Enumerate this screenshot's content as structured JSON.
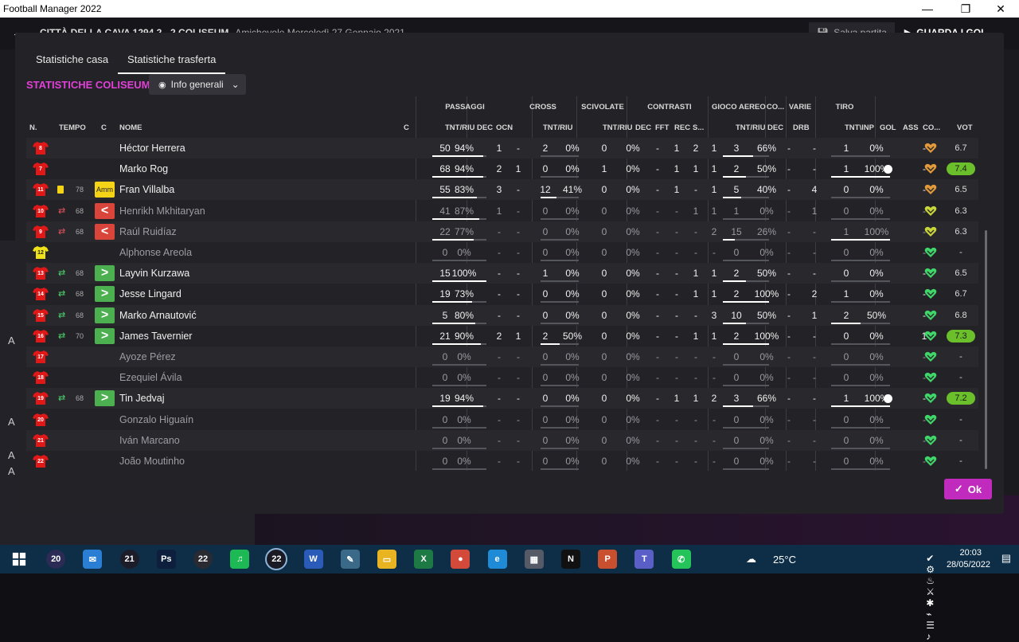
{
  "window": {
    "title": "Football Manager 2022",
    "minimize": "—",
    "maximize": "❐",
    "close": "✕"
  },
  "background": {
    "match_title": "CITTÀ DELLA CAVA 1294 2 - 2 COLISEUM",
    "match_info": "Amichevole   Mercoledì 27 Gennaio 2021",
    "save_label": "Salva partita",
    "watch_label": "GUARDA I GOL",
    "side_letters": [
      "A",
      "A",
      "A",
      "A"
    ]
  },
  "tabs": [
    {
      "label": "Statistiche casa",
      "active": false
    },
    {
      "label": "Statistiche trasferta",
      "active": true
    }
  ],
  "section_title": "STATISTICHE COLISEUM",
  "filter_label": "Info generali",
  "group_headers": [
    "PASSAGGI",
    "CROSS",
    "SCIVOLATE",
    "CONTRASTI",
    "GIOCO AEREO",
    "CO...",
    "VARIE",
    "TIRO"
  ],
  "columns": {
    "n": "N.",
    "tempo": "TEMPO",
    "c": "C",
    "nome": "NOME",
    "c2": "C",
    "pass_tnt": "TNT/RIU",
    "pass_dec": "DEC",
    "pass_ocn": "OCN",
    "cross_tnt": "TNT/RIU",
    "sciv_tnt": "TNT/RIU",
    "con_dec": "DEC",
    "con_fft": "FFT",
    "con_rec": "REC",
    "con_s": "S...",
    "aereo_tnt": "TNT/RIU",
    "co_dec": "DEC",
    "varie_drb": "DRB",
    "tiro_tnt": "TNT\\INP",
    "gol": "GOL",
    "ass": "ASS",
    "co": "CO...",
    "vot": "VOT"
  },
  "players": [
    {
      "n": "8",
      "tempo": "",
      "ev": "",
      "badge": "",
      "name": "Héctor Herrera",
      "dim": false,
      "p": [
        "50",
        "94%",
        "1",
        "-"
      ],
      "cr": [
        "2",
        "0%"
      ],
      "sc": [
        "0",
        "0%"
      ],
      "ct": [
        "-",
        "1",
        "2",
        "1"
      ],
      "ae": [
        "3",
        "66%"
      ],
      "co": "-",
      "drb": "-",
      "ti": [
        "1",
        "0%"
      ],
      "gol": false,
      "ass": "-",
      "heart": "#e39a3a",
      "vot": "6.7",
      "hi": false,
      "pf": 0.94,
      "af": 0.66,
      "tf": 0,
      "cf": 0
    },
    {
      "n": "7",
      "tempo": "",
      "ev": "",
      "badge": "",
      "name": "Marko Rog",
      "dim": false,
      "p": [
        "68",
        "94%",
        "2",
        "1"
      ],
      "cr": [
        "0",
        "0%"
      ],
      "sc": [
        "1",
        "0%"
      ],
      "ct": [
        "-",
        "1",
        "1",
        "1"
      ],
      "ae": [
        "2",
        "50%"
      ],
      "co": "-",
      "drb": "-",
      "ti": [
        "1",
        "100%"
      ],
      "gol": true,
      "ass": "-",
      "heart": "#e39a3a",
      "vot": "7.4",
      "hi": true,
      "pf": 0.94,
      "af": 0.5,
      "tf": 1,
      "cf": 0
    },
    {
      "n": "11",
      "tempo": "78",
      "ev": "yellow",
      "badge": "Amm",
      "name": "Fran Villalba",
      "dim": false,
      "p": [
        "55",
        "83%",
        "3",
        "-"
      ],
      "cr": [
        "12",
        "41%"
      ],
      "sc": [
        "0",
        "0%"
      ],
      "ct": [
        "-",
        "1",
        "-",
        "1"
      ],
      "ae": [
        "5",
        "40%"
      ],
      "co": "-",
      "drb": "4",
      "ti": [
        "0",
        "0%"
      ],
      "gol": false,
      "ass": "-",
      "heart": "#e39a3a",
      "vot": "6.5",
      "hi": false,
      "pf": 0.83,
      "af": 0.4,
      "tf": 0,
      "cf": 0.41
    },
    {
      "n": "10",
      "tempo": "68",
      "ev": "subout",
      "badge": "<",
      "name": "Henrikh Mkhitaryan",
      "dim": true,
      "p": [
        "41",
        "87%",
        "1",
        "-"
      ],
      "cr": [
        "0",
        "0%"
      ],
      "sc": [
        "0",
        "0%"
      ],
      "ct": [
        "-",
        "-",
        "1",
        "1"
      ],
      "ae": [
        "1",
        "0%"
      ],
      "co": "-",
      "drb": "1",
      "ti": [
        "0",
        "0%"
      ],
      "gol": false,
      "ass": "-",
      "heart": "#c9d63a",
      "vot": "6.3",
      "hi": false,
      "pf": 0.87,
      "af": 0,
      "tf": 0,
      "cf": 0
    },
    {
      "n": "9",
      "tempo": "68",
      "ev": "subout",
      "badge": "<",
      "name": "Raúl Ruidíaz",
      "dim": true,
      "p": [
        "22",
        "77%",
        "-",
        "-"
      ],
      "cr": [
        "0",
        "0%"
      ],
      "sc": [
        "0",
        "0%"
      ],
      "ct": [
        "-",
        "-",
        "-",
        "2"
      ],
      "ae": [
        "15",
        "26%"
      ],
      "co": "-",
      "drb": "-",
      "ti": [
        "1",
        "100%"
      ],
      "gol": false,
      "ass": "-",
      "heart": "#c9d63a",
      "vot": "6.3",
      "hi": false,
      "pf": 0.77,
      "af": 0.26,
      "tf": 1,
      "cf": 0
    },
    {
      "n": "12",
      "tempo": "",
      "ev": "",
      "badge": "",
      "name": "Alphonse Areola",
      "dim": true,
      "gk": true,
      "p": [
        "0",
        "0%",
        "-",
        "-"
      ],
      "cr": [
        "0",
        "0%"
      ],
      "sc": [
        "0",
        "0%"
      ],
      "ct": [
        "-",
        "-",
        "-",
        "-"
      ],
      "ae": [
        "0",
        "0%"
      ],
      "co": "-",
      "drb": "-",
      "ti": [
        "0",
        "0%"
      ],
      "gol": false,
      "ass": "-",
      "heart": "#3fd66a",
      "vot": "-",
      "hi": false,
      "pf": 0,
      "af": 0,
      "tf": 0,
      "cf": 0
    },
    {
      "n": "13",
      "tempo": "68",
      "ev": "subin",
      "badge": ">",
      "name": "Layvin Kurzawa",
      "dim": false,
      "p": [
        "15",
        "100%",
        "-",
        "-"
      ],
      "cr": [
        "1",
        "0%"
      ],
      "sc": [
        "0",
        "0%"
      ],
      "ct": [
        "-",
        "-",
        "1",
        "1"
      ],
      "ae": [
        "2",
        "50%"
      ],
      "co": "-",
      "drb": "-",
      "ti": [
        "0",
        "0%"
      ],
      "gol": false,
      "ass": "-",
      "heart": "#3fd66a",
      "vot": "6.5",
      "hi": false,
      "pf": 1,
      "af": 0.5,
      "tf": 0,
      "cf": 0
    },
    {
      "n": "14",
      "tempo": "68",
      "ev": "subin",
      "badge": ">",
      "name": "Jesse Lingard",
      "dim": false,
      "p": [
        "19",
        "73%",
        "-",
        "-"
      ],
      "cr": [
        "0",
        "0%"
      ],
      "sc": [
        "0",
        "0%"
      ],
      "ct": [
        "-",
        "-",
        "1",
        "1"
      ],
      "ae": [
        "2",
        "100%"
      ],
      "co": "-",
      "drb": "2",
      "ti": [
        "1",
        "0%"
      ],
      "gol": false,
      "ass": "-",
      "heart": "#3fd66a",
      "vot": "6.7",
      "hi": false,
      "pf": 0.73,
      "af": 1,
      "tf": 0,
      "cf": 0
    },
    {
      "n": "15",
      "tempo": "68",
      "ev": "subin",
      "badge": ">",
      "name": "Marko Arnautović",
      "dim": false,
      "p": [
        "5",
        "80%",
        "-",
        "-"
      ],
      "cr": [
        "0",
        "0%"
      ],
      "sc": [
        "0",
        "0%"
      ],
      "ct": [
        "-",
        "-",
        "-",
        "3"
      ],
      "ae": [
        "10",
        "50%"
      ],
      "co": "-",
      "drb": "1",
      "ti": [
        "2",
        "50%"
      ],
      "gol": false,
      "ass": "-",
      "heart": "#3fd66a",
      "vot": "6.8",
      "hi": false,
      "pf": 0.8,
      "af": 0.5,
      "tf": 0.5,
      "cf": 0
    },
    {
      "n": "16",
      "tempo": "70",
      "ev": "subin",
      "badge": ">",
      "name": "James Tavernier",
      "dim": false,
      "p": [
        "21",
        "90%",
        "2",
        "1"
      ],
      "cr": [
        "2",
        "50%"
      ],
      "sc": [
        "0",
        "0%"
      ],
      "ct": [
        "-",
        "-",
        "1",
        "1"
      ],
      "ae": [
        "2",
        "100%"
      ],
      "co": "-",
      "drb": "-",
      "ti": [
        "0",
        "0%"
      ],
      "gol": false,
      "ass": "1",
      "heart": "#3fd66a",
      "vot": "7.3",
      "hi": true,
      "pf": 0.9,
      "af": 1,
      "tf": 0,
      "cf": 0.5
    },
    {
      "n": "17",
      "tempo": "",
      "ev": "",
      "badge": "",
      "name": "Ayoze Pérez",
      "dim": true,
      "p": [
        "0",
        "0%",
        "-",
        "-"
      ],
      "cr": [
        "0",
        "0%"
      ],
      "sc": [
        "0",
        "0%"
      ],
      "ct": [
        "-",
        "-",
        "-",
        "-"
      ],
      "ae": [
        "0",
        "0%"
      ],
      "co": "-",
      "drb": "-",
      "ti": [
        "0",
        "0%"
      ],
      "gol": false,
      "ass": "-",
      "heart": "#3fd66a",
      "vot": "-",
      "hi": false,
      "pf": 0,
      "af": 0,
      "tf": 0,
      "cf": 0
    },
    {
      "n": "18",
      "tempo": "",
      "ev": "",
      "badge": "",
      "name": "Ezequiel Ávila",
      "dim": true,
      "p": [
        "0",
        "0%",
        "-",
        "-"
      ],
      "cr": [
        "0",
        "0%"
      ],
      "sc": [
        "0",
        "0%"
      ],
      "ct": [
        "-",
        "-",
        "-",
        "-"
      ],
      "ae": [
        "0",
        "0%"
      ],
      "co": "-",
      "drb": "-",
      "ti": [
        "0",
        "0%"
      ],
      "gol": false,
      "ass": "-",
      "heart": "#3fd66a",
      "vot": "-",
      "hi": false,
      "pf": 0,
      "af": 0,
      "tf": 0,
      "cf": 0
    },
    {
      "n": "19",
      "tempo": "68",
      "ev": "subin",
      "badge": ">",
      "name": "Tin Jedvaj",
      "dim": false,
      "p": [
        "19",
        "94%",
        "-",
        "-"
      ],
      "cr": [
        "0",
        "0%"
      ],
      "sc": [
        "0",
        "0%"
      ],
      "ct": [
        "-",
        "1",
        "1",
        "2"
      ],
      "ae": [
        "3",
        "66%"
      ],
      "co": "-",
      "drb": "-",
      "ti": [
        "1",
        "100%"
      ],
      "gol": true,
      "ass": "-",
      "heart": "#3fd66a",
      "vot": "7.2",
      "hi": true,
      "pf": 0.94,
      "af": 0.66,
      "tf": 1,
      "cf": 0
    },
    {
      "n": "20",
      "tempo": "",
      "ev": "",
      "badge": "",
      "name": "Gonzalo Higuaín",
      "dim": true,
      "p": [
        "0",
        "0%",
        "-",
        "-"
      ],
      "cr": [
        "0",
        "0%"
      ],
      "sc": [
        "0",
        "0%"
      ],
      "ct": [
        "-",
        "-",
        "-",
        "-"
      ],
      "ae": [
        "0",
        "0%"
      ],
      "co": "-",
      "drb": "-",
      "ti": [
        "0",
        "0%"
      ],
      "gol": false,
      "ass": "-",
      "heart": "#3fd66a",
      "vot": "-",
      "hi": false,
      "pf": 0,
      "af": 0,
      "tf": 0,
      "cf": 0
    },
    {
      "n": "21",
      "tempo": "",
      "ev": "",
      "badge": "",
      "name": "Iván Marcano",
      "dim": true,
      "p": [
        "0",
        "0%",
        "-",
        "-"
      ],
      "cr": [
        "0",
        "0%"
      ],
      "sc": [
        "0",
        "0%"
      ],
      "ct": [
        "-",
        "-",
        "-",
        "-"
      ],
      "ae": [
        "0",
        "0%"
      ],
      "co": "-",
      "drb": "-",
      "ti": [
        "0",
        "0%"
      ],
      "gol": false,
      "ass": "-",
      "heart": "#3fd66a",
      "vot": "-",
      "hi": false,
      "pf": 0,
      "af": 0,
      "tf": 0,
      "cf": 0
    },
    {
      "n": "22",
      "tempo": "",
      "ev": "",
      "badge": "",
      "name": "João Moutinho",
      "dim": true,
      "p": [
        "0",
        "0%",
        "-",
        "-"
      ],
      "cr": [
        "0",
        "0%"
      ],
      "sc": [
        "0",
        "0%"
      ],
      "ct": [
        "-",
        "-",
        "-",
        "-"
      ],
      "ae": [
        "0",
        "0%"
      ],
      "co": "-",
      "drb": "-",
      "ti": [
        "0",
        "0%"
      ],
      "gol": false,
      "ass": "-",
      "heart": "#3fd66a",
      "vot": "-",
      "hi": false,
      "pf": 0,
      "af": 0,
      "tf": 0,
      "cf": 0
    }
  ],
  "ok_label": "Ok",
  "taskbar": {
    "apps": [
      {
        "name": "windows-start-icon",
        "label": "",
        "color": "#0d2e46"
      },
      {
        "name": "fm20-icon",
        "label": "20",
        "color": "#2b2b55"
      },
      {
        "name": "mail-icon",
        "label": "✉",
        "color": "#2a7fd4"
      },
      {
        "name": "fm21-icon",
        "label": "21",
        "color": "#1d1d2a"
      },
      {
        "name": "photoshop-icon",
        "label": "Ps",
        "color": "#0d1f3c"
      },
      {
        "name": "fm22-icon",
        "label": "22",
        "color": "#2a2a33"
      },
      {
        "name": "spotify-icon",
        "label": "♫",
        "color": "#1db954"
      },
      {
        "name": "fm22-active-icon",
        "label": "22",
        "color": "#1a1a24"
      },
      {
        "name": "word-icon",
        "label": "W",
        "color": "#2b5bb8"
      },
      {
        "name": "paint-icon",
        "label": "✎",
        "color": "#3a6a88"
      },
      {
        "name": "explorer-icon",
        "label": "▭",
        "color": "#e8b422"
      },
      {
        "name": "excel-icon",
        "label": "X",
        "color": "#1e7a44"
      },
      {
        "name": "chrome-icon",
        "label": "●",
        "color": "#d44a3a"
      },
      {
        "name": "edge-icon",
        "label": "e",
        "color": "#1f8ad6"
      },
      {
        "name": "calculator-icon",
        "label": "▦",
        "color": "#555a66"
      },
      {
        "name": "netflix-icon",
        "label": "N",
        "color": "#111"
      },
      {
        "name": "powerpoint-icon",
        "label": "P",
        "color": "#c8502e"
      },
      {
        "name": "teams-icon",
        "label": "T",
        "color": "#5a5fc8"
      },
      {
        "name": "whatsapp-icon",
        "label": "✆",
        "color": "#25c45a"
      }
    ],
    "weather": "25°C",
    "time": "20:03",
    "date": "28/05/2022",
    "notif": "1"
  },
  "colors": {
    "accent": "#e040d8",
    "ok_button": "#c12bbd",
    "vote_high": "#6bbf2a",
    "sub_badge": "#4caf50",
    "out_badge": "#d9453a",
    "shirt": "#e01818"
  }
}
